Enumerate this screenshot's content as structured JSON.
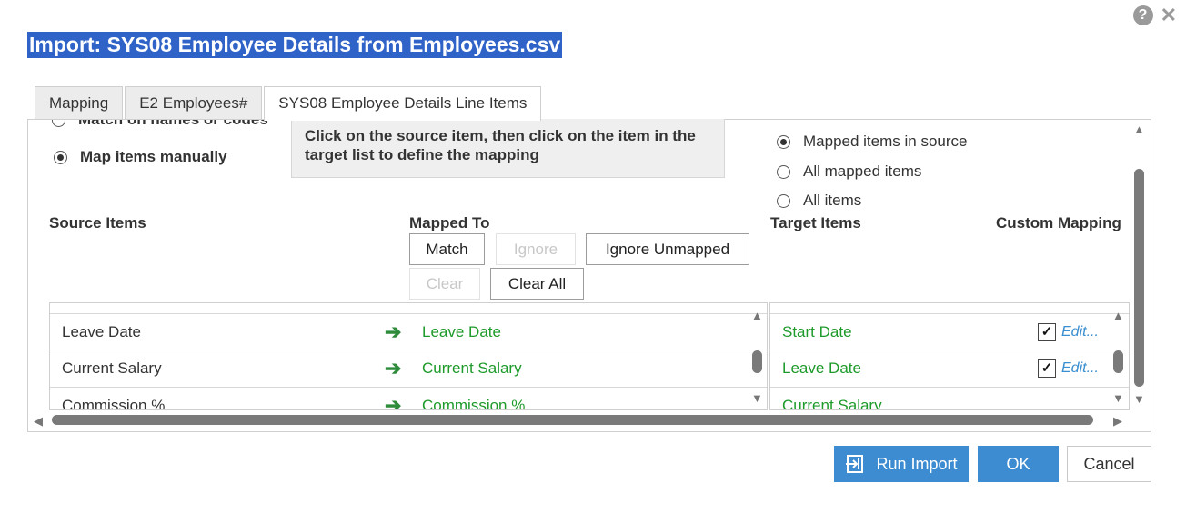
{
  "dialog": {
    "title": "Import: SYS08 Employee Details from Employees.csv",
    "help_icon": "?",
    "close_icon": "✕"
  },
  "tabs": [
    {
      "label": "Mapping",
      "active": false
    },
    {
      "label": "E2 Employees#",
      "active": false
    },
    {
      "label": "SYS08 Employee Details Line Items",
      "active": true
    }
  ],
  "options": {
    "cut_off_option": "Match on names or codes",
    "map_manually": "Map items manually"
  },
  "hint": "Click on the source item, then click on the item in the target list to define the mapping",
  "filter": {
    "items": [
      {
        "label": "Mapped items in source",
        "selected": true
      },
      {
        "label": "All mapped items",
        "selected": false
      },
      {
        "label": "All items",
        "selected": false
      }
    ]
  },
  "columns": {
    "source": "Source Items",
    "mapped": "Mapped To",
    "target": "Target Items",
    "custom": "Custom Mapping"
  },
  "buttons": {
    "match": "Match",
    "ignore": "Ignore",
    "ignore_unmapped": "Ignore Unmapped",
    "clear": "Clear",
    "clear_all": "Clear All"
  },
  "source_rows": [
    {
      "source": "Leave Date",
      "mapped": "Leave Date"
    },
    {
      "source": "Current Salary",
      "mapped": "Current Salary"
    },
    {
      "source": "Commission %",
      "mapped": "Commission %"
    }
  ],
  "target_rows": [
    {
      "label": "Start Date",
      "checked": true,
      "edit": "Edit..."
    },
    {
      "label": "Leave Date",
      "checked": true,
      "edit": "Edit..."
    },
    {
      "label": "Current Salary",
      "checked": false,
      "edit": ""
    }
  ],
  "footer": {
    "run_import": "Run Import",
    "ok": "OK",
    "cancel": "Cancel"
  },
  "colors": {
    "accent": "#3d8bd0",
    "title_bg": "#2f63c8",
    "mapped_text": "#1d9a2a",
    "edit_link": "#3a8fd0"
  }
}
